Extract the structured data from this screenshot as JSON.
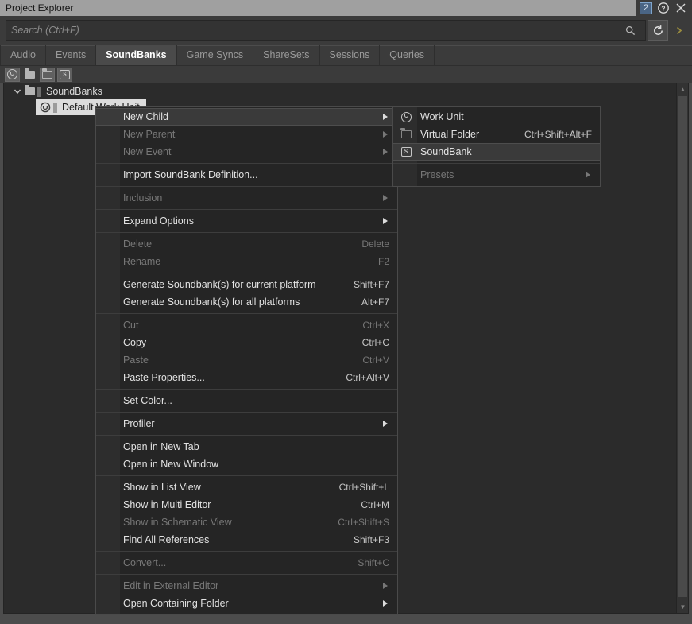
{
  "window": {
    "title": "Project Explorer",
    "badge_count": "2",
    "help_icon": "help-icon",
    "close_icon": "close-icon"
  },
  "search": {
    "placeholder": "Search (Ctrl+F)",
    "value": "",
    "magnifier_icon": "search-icon",
    "reset_icon": "reset-icon",
    "next_icon": "chevron-right-icon"
  },
  "tabs": [
    {
      "label": "Audio",
      "active": false
    },
    {
      "label": "Events",
      "active": false
    },
    {
      "label": "SoundBanks",
      "active": true
    },
    {
      "label": "Game Syncs",
      "active": false
    },
    {
      "label": "ShareSets",
      "active": false
    },
    {
      "label": "Sessions",
      "active": false
    },
    {
      "label": "Queries",
      "active": false
    }
  ],
  "toolbar_icons": [
    {
      "name": "new-work-unit-icon"
    },
    {
      "name": "new-folder-icon"
    },
    {
      "name": "new-virtual-folder-icon"
    },
    {
      "name": "new-soundbank-icon"
    }
  ],
  "tree": {
    "root": {
      "label": "SoundBanks",
      "icon": "folder-icon",
      "expanded": true
    },
    "child": {
      "label": "Default Work Unit",
      "icon": "work-unit-icon",
      "selected": true
    }
  },
  "context_menu": {
    "items": [
      {
        "label": "New Child",
        "accel": "",
        "disabled": false,
        "submenu": true,
        "hover": true
      },
      {
        "label": "New Parent",
        "accel": "",
        "disabled": true,
        "submenu": true
      },
      {
        "label": "New Event",
        "accel": "",
        "disabled": true,
        "submenu": true
      },
      {
        "separator": true
      },
      {
        "label": "Import SoundBank Definition...",
        "accel": "",
        "disabled": false,
        "submenu": false
      },
      {
        "separator": true
      },
      {
        "label": "Inclusion",
        "accel": "",
        "disabled": true,
        "submenu": true
      },
      {
        "separator": true
      },
      {
        "label": "Expand Options",
        "accel": "",
        "disabled": false,
        "submenu": true
      },
      {
        "separator": true
      },
      {
        "label": "Delete",
        "accel": "Delete",
        "disabled": true,
        "submenu": false
      },
      {
        "label": "Rename",
        "accel": "F2",
        "disabled": true,
        "submenu": false
      },
      {
        "separator": true
      },
      {
        "label": "Generate Soundbank(s) for current platform",
        "accel": "Shift+F7",
        "disabled": false,
        "submenu": false
      },
      {
        "label": "Generate Soundbank(s) for all platforms",
        "accel": "Alt+F7",
        "disabled": false,
        "submenu": false
      },
      {
        "separator": true
      },
      {
        "label": "Cut",
        "accel": "Ctrl+X",
        "disabled": true,
        "submenu": false
      },
      {
        "label": "Copy",
        "accel": "Ctrl+C",
        "disabled": false,
        "submenu": false
      },
      {
        "label": "Paste",
        "accel": "Ctrl+V",
        "disabled": true,
        "submenu": false
      },
      {
        "label": "Paste Properties...",
        "accel": "Ctrl+Alt+V",
        "disabled": false,
        "submenu": false
      },
      {
        "separator": true
      },
      {
        "label": "Set Color...",
        "accel": "",
        "disabled": false,
        "submenu": false
      },
      {
        "separator": true
      },
      {
        "label": "Profiler",
        "accel": "",
        "disabled": false,
        "submenu": true
      },
      {
        "separator": true
      },
      {
        "label": "Open in New Tab",
        "accel": "",
        "disabled": false,
        "submenu": false
      },
      {
        "label": "Open in New Window",
        "accel": "",
        "disabled": false,
        "submenu": false
      },
      {
        "separator": true
      },
      {
        "label": "Show in List View",
        "accel": "Ctrl+Shift+L",
        "disabled": false,
        "submenu": false
      },
      {
        "label": "Show in Multi Editor",
        "accel": "Ctrl+M",
        "disabled": false,
        "submenu": false
      },
      {
        "label": "Show in Schematic View",
        "accel": "Ctrl+Shift+S",
        "disabled": true,
        "submenu": false
      },
      {
        "label": "Find All References",
        "accel": "Shift+F3",
        "disabled": false,
        "submenu": false
      },
      {
        "separator": true
      },
      {
        "label": "Convert...",
        "accel": "Shift+C",
        "disabled": true,
        "submenu": false
      },
      {
        "separator": true
      },
      {
        "label": "Edit in External Editor",
        "accel": "",
        "disabled": true,
        "submenu": true
      },
      {
        "label": "Open Containing Folder",
        "accel": "",
        "disabled": false,
        "submenu": true
      }
    ]
  },
  "submenu": {
    "items": [
      {
        "label": "Work Unit",
        "accel": "",
        "icon": "work-unit-icon",
        "disabled": false,
        "submenu": false,
        "hover": false
      },
      {
        "label": "Virtual Folder",
        "accel": "Ctrl+Shift+Alt+F",
        "icon": "virtual-folder-icon",
        "disabled": false,
        "submenu": false,
        "hover": false
      },
      {
        "label": "SoundBank",
        "accel": "",
        "icon": "soundbank-icon",
        "disabled": false,
        "submenu": false,
        "hover": true
      },
      {
        "separator": true
      },
      {
        "label": "Presets",
        "accel": "",
        "icon": "",
        "disabled": true,
        "submenu": true,
        "hover": false
      }
    ]
  },
  "colors": {
    "titlebar": "#a0a0a0",
    "chrome": "#3b3b3b",
    "panel": "#2b2b2b",
    "menu": "#252525",
    "menu_gutter": "#2d2d2d",
    "hover": "#3a3a3a",
    "accent_badge": "#4a6585",
    "selection": "#dcdcdc"
  }
}
